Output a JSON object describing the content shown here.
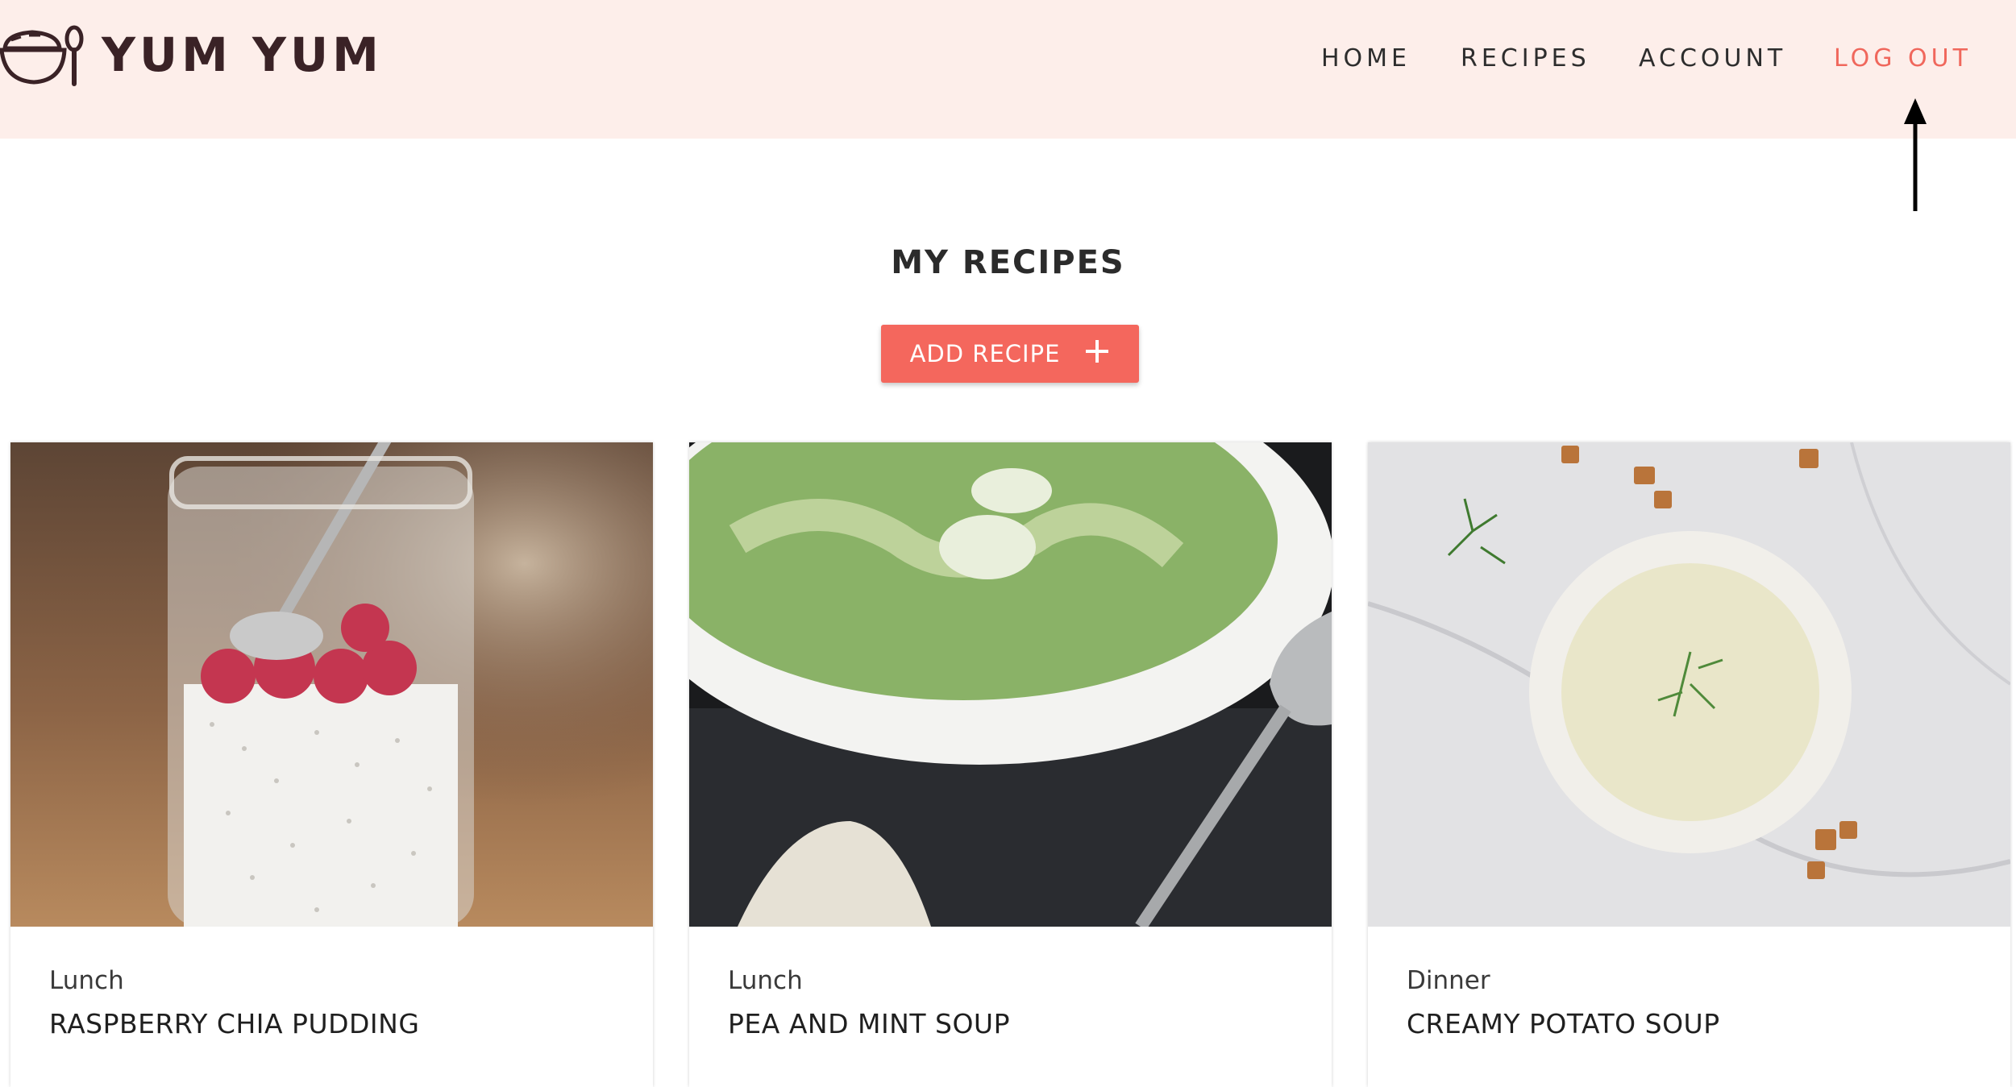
{
  "brand": {
    "name": "YUM YUM",
    "logo_icon": "bowl-spoon-icon"
  },
  "nav": {
    "home": "HOME",
    "recipes": "RECIPES",
    "account": "ACCOUNT",
    "logout": "LOG OUT"
  },
  "page": {
    "title": "MY RECIPES",
    "add_button": "ADD RECIPE",
    "add_icon": "plus-icon"
  },
  "recipes": [
    {
      "category": "Lunch",
      "title": "RASPBERRY CHIA PUDDING",
      "image": "chia-pudding-jar-photo"
    },
    {
      "category": "Lunch",
      "title": "PEA AND MINT SOUP",
      "image": "green-soup-bowl-photo"
    },
    {
      "category": "Dinner",
      "title": "CREAMY POTATO SOUP",
      "image": "potato-soup-bowl-photo"
    }
  ],
  "colors": {
    "header_bg": "#fdeeea",
    "accent": "#f4675d",
    "logout_text": "#f0675c",
    "brand_text": "#3a2226"
  }
}
